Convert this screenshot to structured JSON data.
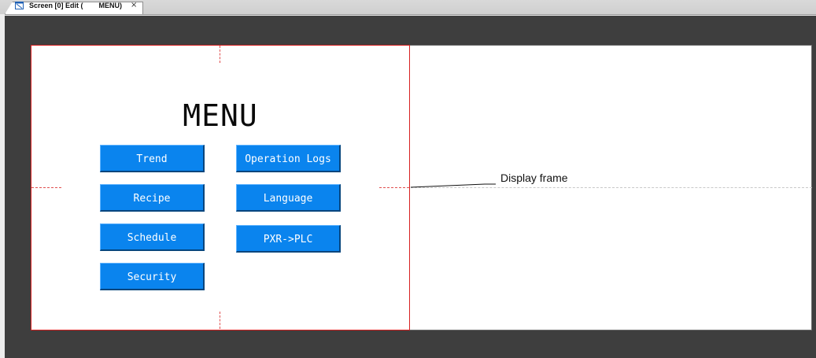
{
  "tab": {
    "label": "Screen [0] Edit (        MENU)",
    "icon": "screen-edit-icon",
    "close_symbol": "×"
  },
  "screen": {
    "title": "MENU",
    "buttons": [
      {
        "label": "Trend"
      },
      {
        "label": "Operation Logs"
      },
      {
        "label": "Recipe"
      },
      {
        "label": "Language"
      },
      {
        "label": "Schedule"
      },
      {
        "label": "PXR->PLC"
      },
      {
        "label": "Security"
      }
    ],
    "button_color": "#0a84ee",
    "frame_color": "#d72020"
  },
  "annotation": {
    "label": "Display frame"
  },
  "colors": {
    "workspace": "#3e3e3e",
    "canvas": "#ffffff"
  }
}
